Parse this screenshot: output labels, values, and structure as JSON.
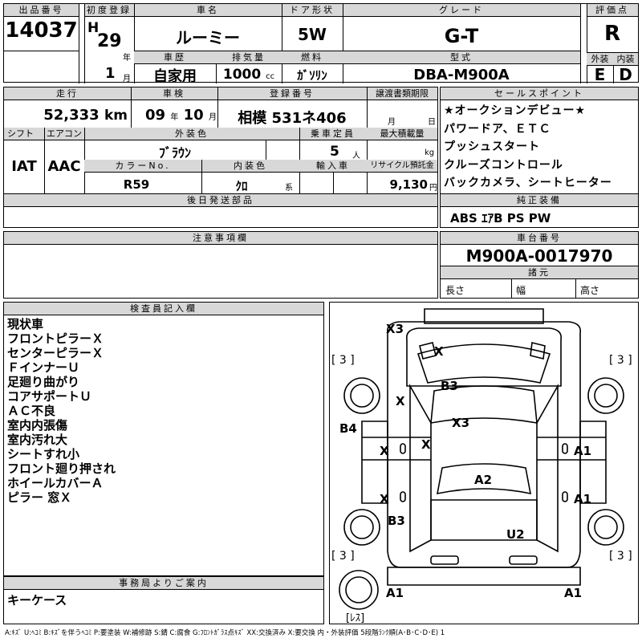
{
  "header": {
    "lot_label": "出品番号",
    "lot_no": "14037",
    "first_reg_label": "初度登録",
    "era": "H",
    "year": "29",
    "year_unit": "年",
    "month": "1",
    "month_unit": "月",
    "car_name_label": "車名",
    "car_name": "ルーミー",
    "door_label": "ドア形状",
    "door": "5W",
    "grade_label": "グレード",
    "grade": "G-T",
    "score_label": "評価点",
    "score": "R",
    "history_label": "車歴",
    "history": "自家用",
    "displacement_label": "排気量",
    "displacement": "1000",
    "displacement_unit": "cc",
    "fuel_label": "燃料",
    "fuel": "ｶﾞｿﾘﾝ",
    "model_label": "型式",
    "model": "DBA-M900A",
    "exterior_label": "外装",
    "exterior": "E",
    "interior_label": "内装",
    "interior": "D"
  },
  "row2": {
    "mileage_label": "走行",
    "mileage": "52,333",
    "mileage_unit": "km",
    "inspection_label": "車検",
    "insp_year": "09",
    "insp_year_unit": "年",
    "insp_month": "10",
    "insp_month_unit": "月",
    "reg_no_label": "登録番号",
    "reg_no": "相模 531ネ406",
    "transfer_label": "譲渡書類期限",
    "transfer_month_unit": "月",
    "transfer_day_unit": "日",
    "shift_label": "シフト",
    "shift": "IAT",
    "aircon_label": "エアコン",
    "aircon": "AAC",
    "ext_color_label": "外装色",
    "ext_color": "ﾌﾞﾗｳﾝ",
    "capacity_label": "乗車定員",
    "capacity": "5",
    "capacity_unit": "人",
    "max_load_label": "最大積載量",
    "max_load_unit": "kg",
    "color_no_label": "カラーNo.",
    "color_no": "R59",
    "int_color_label": "内装色",
    "int_color": "ｸﾛ",
    "int_color_unit": "系",
    "import_label": "輸入車",
    "recycle_label": "リサイクル預託金",
    "recycle": "9,130",
    "recycle_unit": "円"
  },
  "later_parts_label": "後日発送部品",
  "sales_point_label": "セールスポイント",
  "sales_points": [
    "★オークションデビュー★",
    "パワードア、ＥＴＣ",
    "プッシュスタート",
    "クルーズコントロール",
    "バックカメラ、シートヒーター"
  ],
  "equipment_label": "純正装備",
  "equipment": "ABS ｴｱB PS PW",
  "notes_label": "注意事項欄",
  "chassis_label": "車台番号",
  "chassis": "M900A-0017970",
  "specs_label": "諸元",
  "length_label": "長さ",
  "width_label": "幅",
  "height_label": "高さ",
  "inspector_label": "検査員記入欄",
  "inspector_notes": [
    "現状車",
    "フロントピラーＸ",
    "センターピラーＸ",
    "ＦインナーＵ",
    "足廻り曲がり",
    "コアサポートＵ",
    "ＡＣ不良",
    "室内内張傷",
    "室内汚れ大",
    "シートすれ小",
    "フロント廻り押され",
    "ホイールカバーＡ",
    "ピラー 窓Ｘ"
  ],
  "office_label": "事務局よりご案内",
  "office_notes": [
    "キーケース"
  ],
  "diagram": {
    "tires": [
      "[ 3 ]",
      "[ 3 ]",
      "[ 3 ]",
      "[ 3 ]"
    ],
    "marks": [
      "X3",
      "X",
      "B3",
      "X",
      "X3",
      "B4",
      "X",
      "X",
      "A1",
      "A2",
      "X",
      "A1",
      "B3",
      "U2",
      "A1",
      "A1"
    ],
    "spare_tire": "[ﾚｽ]"
  },
  "legend": "A:ｷｽﾞ U:ﾍｺﾐ B:ｷｽﾞを伴うﾍｺﾐ P:要塗装 W:補修跡 S:錆 C:腐食 G:ﾌﾛﾝﾄｶﾞﾗｽ点ｷｽﾞ XX:交換済み X:要交換 内・外装評価 5段階ﾗﾝｸ順(A･B･C･D･E) 1"
}
